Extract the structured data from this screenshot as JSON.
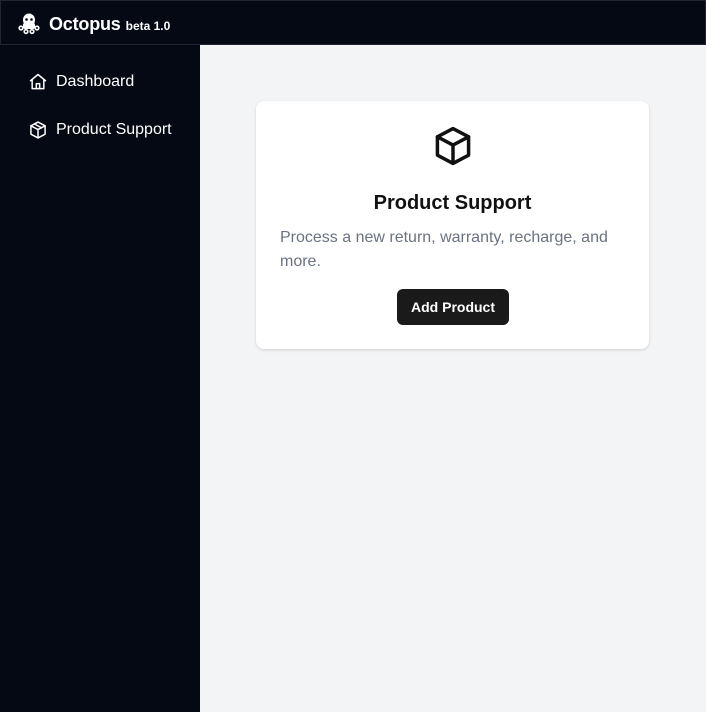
{
  "app": {
    "name": "Octopus",
    "version": "beta 1.0",
    "logo_icon": "octopus-icon"
  },
  "sidebar": {
    "items": [
      {
        "label": "Dashboard",
        "icon": "home-icon"
      },
      {
        "label": "Product Support",
        "icon": "box-icon"
      }
    ]
  },
  "card": {
    "icon": "box-icon",
    "title": "Product Support",
    "description": "Process a new return, warranty, recharge, and more.",
    "button_label": "Add Product"
  },
  "colors": {
    "topbar_bg": "#050914",
    "sidebar_bg": "#050914",
    "main_bg": "#f3f4f6",
    "card_bg": "#ffffff",
    "button_bg": "#1a1a1a",
    "text_muted": "#6b7280"
  }
}
